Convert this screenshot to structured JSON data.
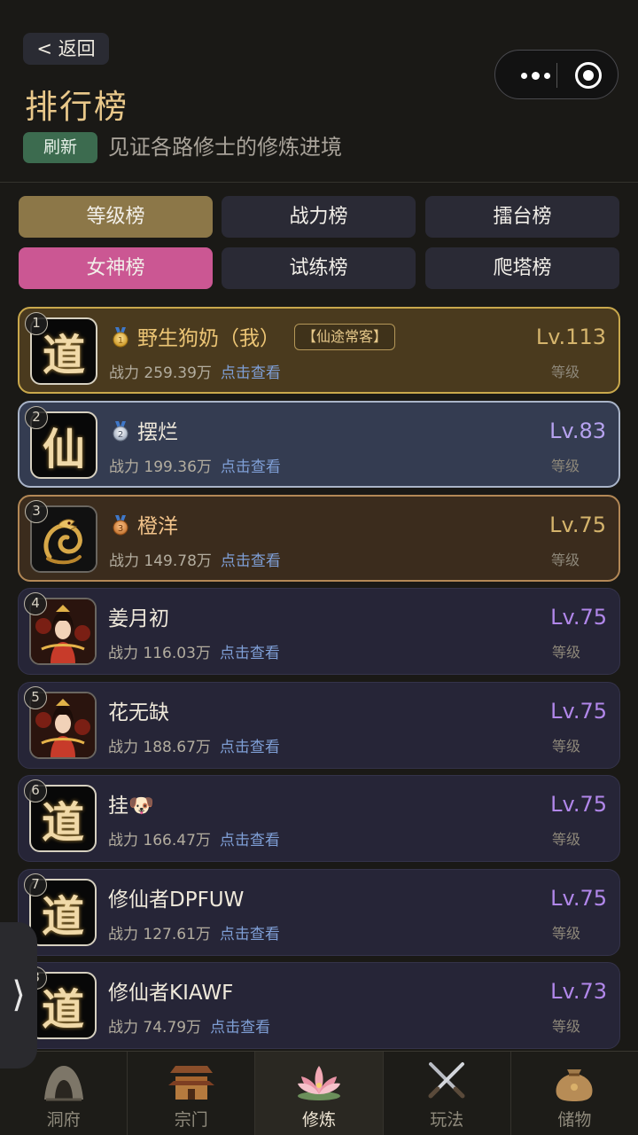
{
  "header": {
    "back_label": "< 返回",
    "title": "排行榜",
    "refresh_label": "刷新",
    "subtitle": "见证各路修士的修炼进境"
  },
  "tabs": [
    {
      "label": "等级榜",
      "state": "selected"
    },
    {
      "label": "战力榜"
    },
    {
      "label": "擂台榜"
    },
    {
      "label": "女神榜",
      "state": "highlight"
    },
    {
      "label": "试练榜"
    },
    {
      "label": "爬塔榜"
    }
  ],
  "ranking": {
    "power_prefix": "战力",
    "view_label": "点击查看",
    "level_label": "等级",
    "entries": [
      {
        "rank": "1",
        "name": "野生狗奶（我）",
        "badge": "【仙途常客】",
        "power": "259.39万",
        "level": "Lv.113",
        "avatar": "道",
        "medal": "gold-medal-icon"
      },
      {
        "rank": "2",
        "name": "摆烂",
        "power": "199.36万",
        "level": "Lv.83",
        "avatar": "仙",
        "medal": "silver-medal-icon"
      },
      {
        "rank": "3",
        "name": "橙洋",
        "power": "149.78万",
        "level": "Lv.75",
        "avatar": "dragon-avatar",
        "medal": "bronze-medal-icon"
      },
      {
        "rank": "4",
        "name": "姜月初",
        "power": "116.03万",
        "level": "Lv.75",
        "avatar": "goddess-avatar"
      },
      {
        "rank": "5",
        "name": "花无缺",
        "power": "188.67万",
        "level": "Lv.75",
        "avatar": "goddess-avatar"
      },
      {
        "rank": "6",
        "name": "挂🐶",
        "power": "166.47万",
        "level": "Lv.75",
        "avatar": "道"
      },
      {
        "rank": "7",
        "name": "修仙者DPFUW",
        "power": "127.61万",
        "level": "Lv.75",
        "avatar": "道"
      },
      {
        "rank": "8",
        "name": "修仙者KIAWF",
        "power": "74.79万",
        "level": "Lv.73",
        "avatar": "道"
      }
    ]
  },
  "side_handle": "⟩",
  "bottom_nav": [
    {
      "label": "洞府",
      "icon": "cave-icon"
    },
    {
      "label": "宗门",
      "icon": "temple-icon"
    },
    {
      "label": "修炼",
      "icon": "lotus-icon",
      "active": true
    },
    {
      "label": "玩法",
      "icon": "crossed-swords-icon"
    },
    {
      "label": "储物",
      "icon": "pouch-icon"
    }
  ],
  "colors": {
    "gold": "#e9c88a",
    "level_purple": "#b187ea",
    "link_blue": "#7f9fd6",
    "pink_tab": "#cb5793",
    "gold_tab": "#8c7748"
  }
}
